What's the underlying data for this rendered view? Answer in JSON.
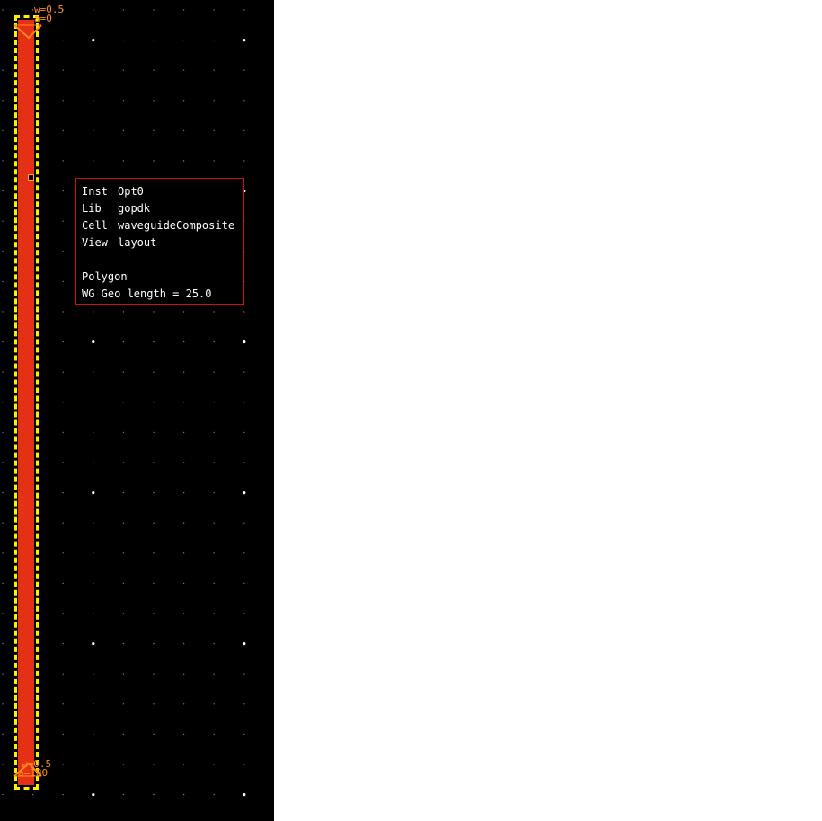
{
  "layout_view": {
    "background": "#000000",
    "waveguide_color": "#e53017",
    "selection_color": "#ffee00",
    "pin_label_color": "#ff8c1a",
    "top_pin": {
      "width_label": "w=0.5",
      "angle_label": "a=0"
    },
    "bottom_pin": {
      "width_label": "w=0.5",
      "angle_label": "a=180"
    }
  },
  "info_popup": {
    "border_color": "#d01010",
    "rows": [
      {
        "key": "Inst",
        "value": "Opt0"
      },
      {
        "key": "Lib",
        "value": "gopdk"
      },
      {
        "key": "Cell",
        "value": "waveguideComposite"
      },
      {
        "key": "View",
        "value": "layout"
      }
    ],
    "separator": "------------",
    "object_type": "Polygon",
    "property": "WG Geo length = 25.0"
  }
}
